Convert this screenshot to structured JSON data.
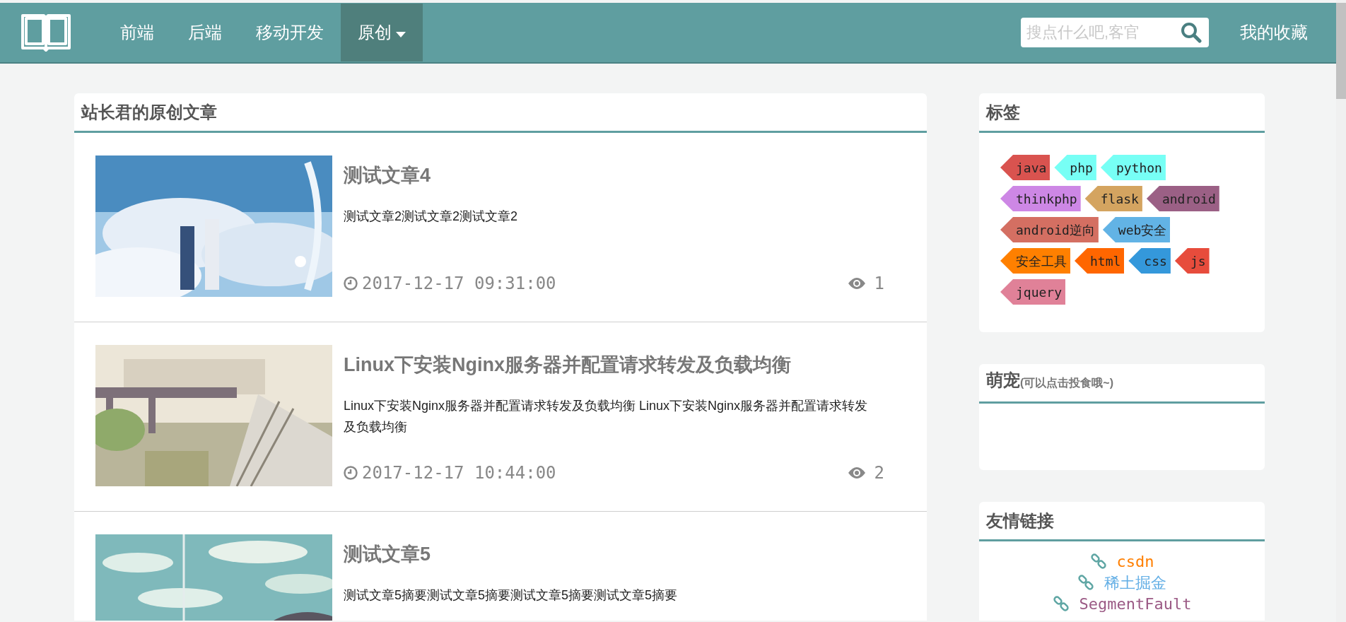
{
  "nav": {
    "items": [
      {
        "label": "前端",
        "selected": false,
        "dropdown": false
      },
      {
        "label": "后端",
        "selected": false,
        "dropdown": false
      },
      {
        "label": "移动开发",
        "selected": false,
        "dropdown": false
      },
      {
        "label": "原创",
        "selected": true,
        "dropdown": true
      }
    ],
    "search": {
      "placeholder": "搜点什么吧,客官"
    },
    "favorites": "我的收藏"
  },
  "articles_panel": {
    "title": "站长君的原创文章",
    "articles": [
      {
        "title": "测试文章4",
        "summary": "测试文章2测试文章2测试文章2",
        "date": "2017-12-17 09:31:00",
        "views": "1"
      },
      {
        "title": "Linux下安装Nginx服务器并配置请求转发及负载均衡",
        "summary": "Linux下安装Nginx服务器并配置请求转发及负载均衡 Linux下安装Nginx服务器并配置请求转发及负载均衡",
        "date": "2017-12-17 10:44:00",
        "views": "2"
      },
      {
        "title": "测试文章5",
        "summary": "测试文章5摘要测试文章5摘要测试文章5摘要测试文章5摘要"
      }
    ]
  },
  "tags_panel": {
    "title": "标签",
    "tags": [
      {
        "label": "java",
        "color": "#d9534f"
      },
      {
        "label": "php",
        "color": "#77fff5"
      },
      {
        "label": "python",
        "color": "#77fff5"
      },
      {
        "label": "thinkphp",
        "color": "#cd87e5"
      },
      {
        "label": "flask",
        "color": "#d4a460"
      },
      {
        "label": "android",
        "color": "#9b6085"
      },
      {
        "label": "android逆向",
        "color": "#d46f62"
      },
      {
        "label": "web安全",
        "color": "#62b3e5"
      },
      {
        "label": "安全工具",
        "color": "#ff8000"
      },
      {
        "label": "html",
        "color": "#ff6600"
      },
      {
        "label": "css",
        "color": "#3498db"
      },
      {
        "label": "js",
        "color": "#e74c3c"
      },
      {
        "label": "jquery",
        "color": "#e08198"
      }
    ]
  },
  "pet_panel": {
    "title": "萌宠",
    "note": "(可以点击投食哦~)"
  },
  "links_panel": {
    "title": "友情链接",
    "links": [
      {
        "label": "csdn",
        "color": "#ff7f00"
      },
      {
        "label": "稀土掘金",
        "color": "#62aee5"
      },
      {
        "label": "SegmentFault",
        "color": "#9b5a85"
      }
    ]
  }
}
